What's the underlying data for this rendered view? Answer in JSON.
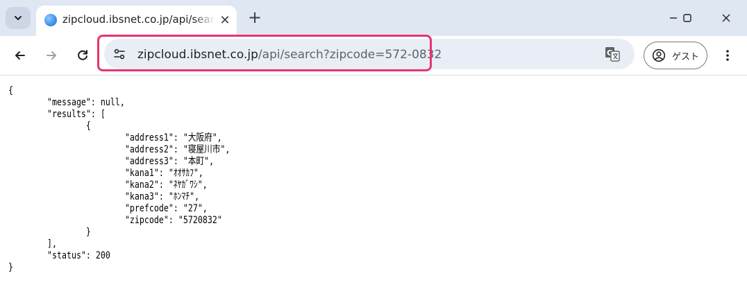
{
  "browser": {
    "tab": {
      "title": "zipcloud.ibsnet.co.jp/api/search?zipcode=572-0832",
      "close_glyph": "✕"
    },
    "new_tab_glyph": "+",
    "address_bar": {
      "host": "zipcloud.ibsnet.co.jp",
      "path": "/api/search?zipcode=572-0832"
    },
    "profile": {
      "label": "ゲスト"
    },
    "icons": {
      "tab_search": "chevron-down-icon",
      "favicon": "globe-favicon-icon",
      "minimize": "minimize-icon",
      "maximize": "maximize-icon",
      "close": "close-icon",
      "back": "arrow-left-icon",
      "forward": "arrow-right-icon",
      "reload": "reload-icon",
      "site_info": "tune-icon",
      "translate": "translate-icon",
      "profile": "person-icon",
      "menu": "kebab-menu-icon"
    },
    "colors": {
      "tab_strip": "#dfe7f3",
      "omnibox": "#e9eef6",
      "highlight": "#e8336f"
    }
  },
  "response_text": "{\n        \"message\": null,\n        \"results\": [\n                {\n                        \"address1\": \"大阪府\",\n                        \"address2\": \"寝屋川市\",\n                        \"address3\": \"本町\",\n                        \"kana1\": \"ｵｵｻｶﾌ\",\n                        \"kana2\": \"ﾈﾔｶﾞﾜｼ\",\n                        \"kana3\": \"ﾎﾝﾏﾁ\",\n                        \"prefcode\": \"27\",\n                        \"zipcode\": \"5720832\"\n                }\n        ],\n        \"status\": 200\n}"
}
